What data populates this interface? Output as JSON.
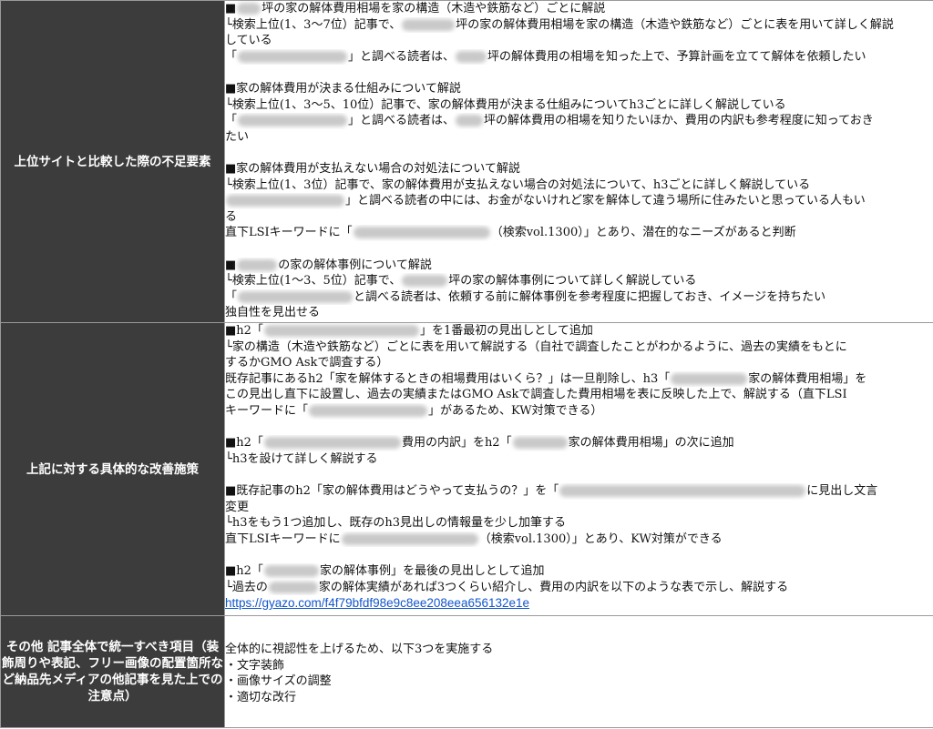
{
  "rows": [
    {
      "label": "上位サイトと比較した際の不足要素",
      "lines": [
        [
          "■",
          "坪の家の解体費用相場を家の構造（木造や鉄筋など）ごとに解説"
        ],
        [
          "└検索上位(1、3〜7位）記事で、",
          "坪の家の解体費用相場を家の構造（木造や鉄筋など）ごとに表を用いて詳しく解説"
        ],
        [
          "している"
        ],
        [
          "「",
          "」と調べる読者は、",
          "坪の解体費用の相場を知った上で、予算計画を立てて解体を依頼したい"
        ],
        [],
        [
          "■家の解体費用が決まる仕組みについて解説"
        ],
        [
          "└検索上位(1、3〜5、10位）記事で、家の解体費用が決まる仕組みについてh3ごとに詳しく解説している"
        ],
        [
          "「",
          "」と調べる読者は、",
          "坪の解体費用の相場を知りたいほか、費用の内訳も参考程度に知っておき"
        ],
        [
          "たい"
        ],
        [],
        [
          "■家の解体費用が支払えない場合の対処法について解説"
        ],
        [
          "└検索上位(1、3位）記事で、家の解体費用が支払えない場合の対処法について、h3ごとに詳しく解説している"
        ],
        [
          "",
          "」と調べる読者の中には、お金がないけれど家を解体して違う場所に住みたいと思っている人もい"
        ],
        [
          "る"
        ],
        [
          "直下LSIキーワードに「",
          "（検索vol.1300）」とあり、潜在的なニーズがあると判断"
        ],
        [],
        [
          "■",
          "の家の解体事例について解説"
        ],
        [
          "└検索上位(1〜3、5位）記事で、",
          "坪の家の解体事例について詳しく解説している"
        ],
        [
          "「",
          "と調べる読者は、依頼する前に解体事例を参考程度に把握しておき、イメージを持ちたい"
        ],
        [
          " 独自性を見出せる"
        ]
      ]
    },
    {
      "label": "上記に対する具体的な改善施策",
      "lines": [
        [
          "■h2「",
          "」を1番最初の見出しとして追加"
        ],
        [
          "└家の構造（木造や鉄筋など）ごとに表を用いて解説する（自社で調査したことがわかるように、過去の実績をもとに"
        ],
        [
          "するかGMO Askで調査する）"
        ],
        [
          "  既存記事にあるh2「家を解体するときの相場費用はいくら？」は一旦削除し、h3「",
          "家の解体費用相場」を"
        ],
        [
          "この見出し直下に設置し、過去の実績またはGMO Askで調査した費用相場を表に反映した上で、解説する（直下LSI"
        ],
        [
          "キーワードに「",
          "」があるため、KW対策できる）"
        ],
        [],
        [
          "■h2「",
          "費用の内訳」をh2「",
          "家の解体費用相場」の次に追加"
        ],
        [
          "└h3を設けて詳しく解説する"
        ],
        [],
        [
          "■既存記事のh2「家の解体費用はどうやって支払うの？」を「",
          "に見出し文言"
        ],
        [
          "変更"
        ],
        [
          "└h3をもう1つ追加し、既存のh3見出しの情報量を少し加筆する"
        ],
        [
          "  直下LSIキーワードに",
          "（検索vol.1300）」とあり、KW対策ができる"
        ],
        [],
        [
          "■h2「",
          "家の解体事例」を最後の見出しとして追加"
        ],
        [
          "└過去の",
          "家の解体実績があれば3つくらい紹介し、費用の内訳を以下のような表で示し、解説する"
        ]
      ],
      "link": "https://gyazo.com/f4f79bfdf98e9c8ee208eea656132e1e"
    },
    {
      "label": "その他 記事全体で統一すべき項目（装飾周りや表記、フリー画像の配置箇所など納品先メディアの他記事を見た上での注意点）",
      "lines": [
        [
          "全体的に視認性を上げるため、以下3つを実施する"
        ],
        [
          "・文字装飾"
        ],
        [
          "・画像サイズの調整"
        ],
        [
          "・適切な改行"
        ]
      ]
    }
  ]
}
